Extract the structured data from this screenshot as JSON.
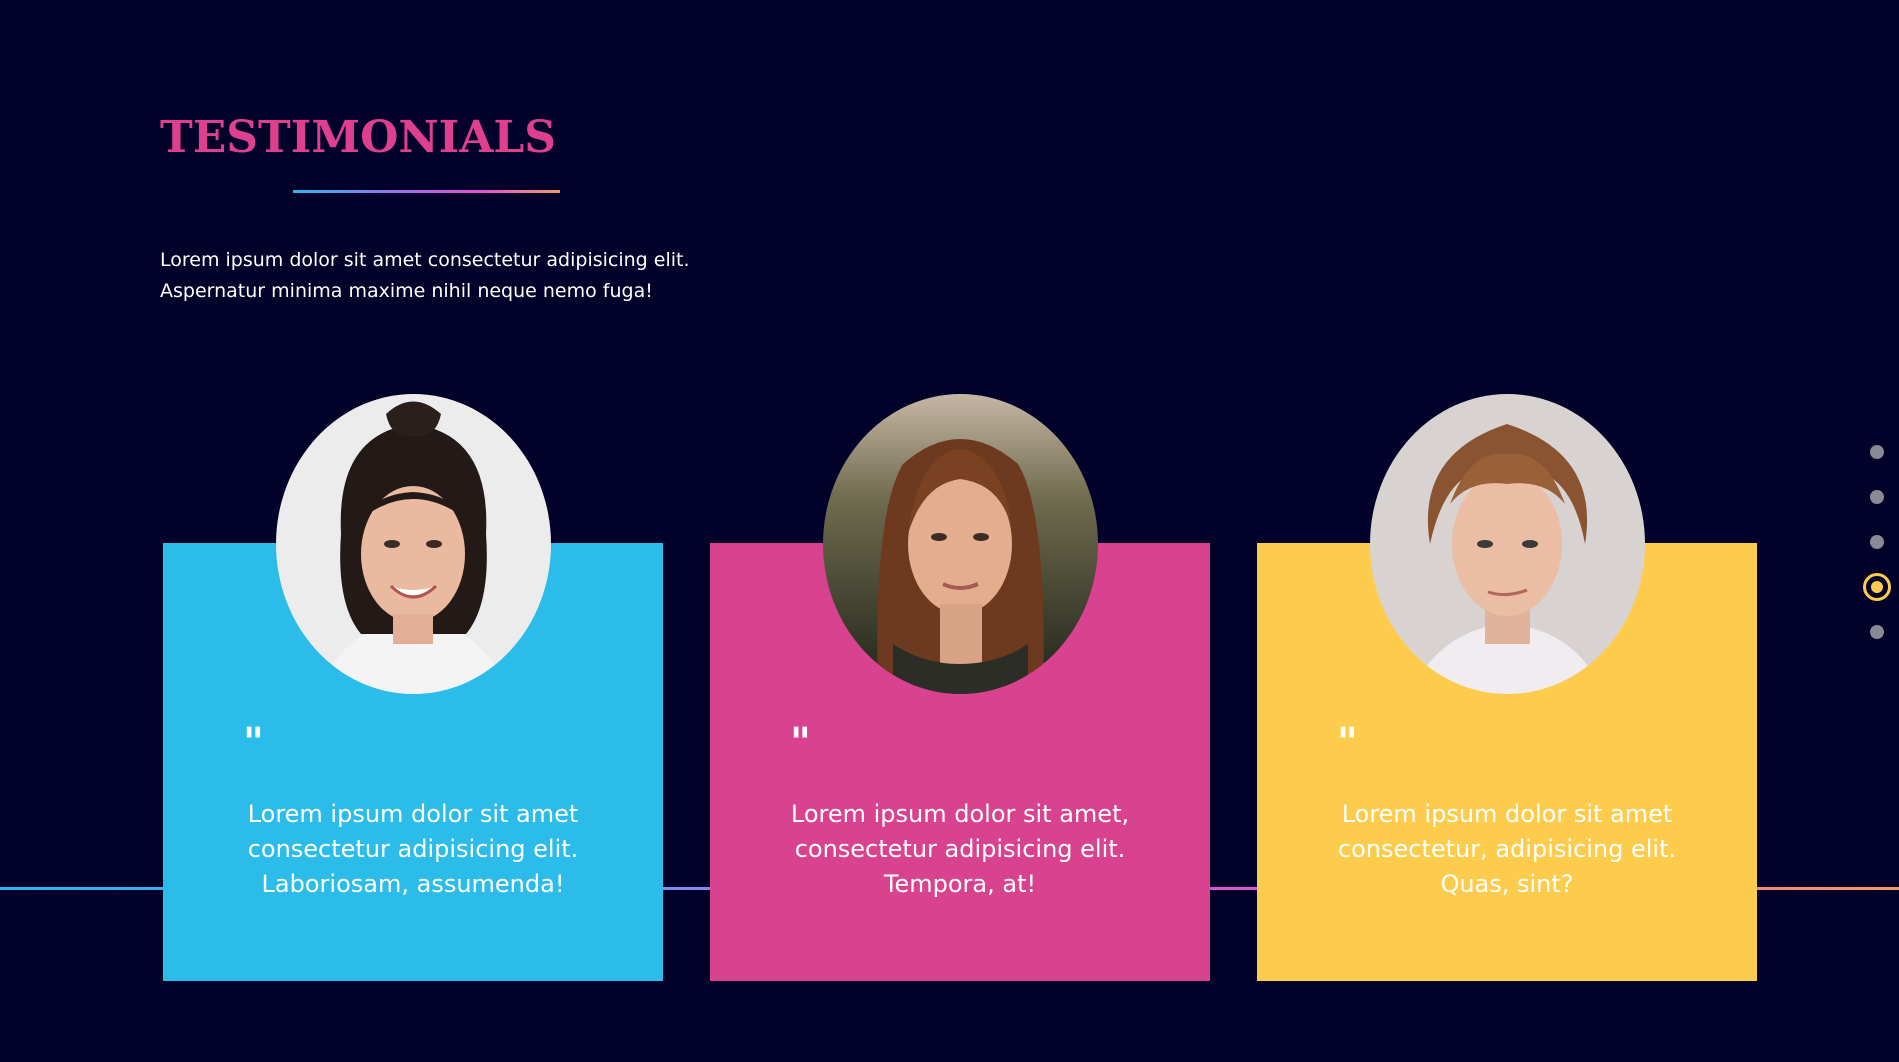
{
  "section": {
    "title": "TESTIMONIALS",
    "intro_line1": "Lorem ipsum dolor sit amet consectetur adipisicing elit.",
    "intro_line2": "Aspernatur minima maxime nihil neque nemo fuga!"
  },
  "testimonials": [
    {
      "color": "#2bbcea",
      "quote_icon": "quote-icon",
      "lines": [
        "Lorem ipsum dolor sit amet",
        "consectetur adipisicing elit.",
        "Laboriosam, assumenda!"
      ]
    },
    {
      "color": "#d9428f",
      "quote_icon": "quote-icon",
      "lines": [
        "Lorem ipsum dolor sit amet,",
        "consectetur adipisicing elit.",
        "Tempora, at!"
      ]
    },
    {
      "color": "#fdcc4c",
      "quote_icon": "quote-icon",
      "lines": [
        "Lorem ipsum dolor sit amet",
        "consectetur, adipisicing elit.",
        "Quas, sint?"
      ]
    }
  ],
  "quote_mark": "\"",
  "pagination": {
    "count": 5,
    "active_index": 3,
    "active_color": "#fdcc4c"
  },
  "colors": {
    "background": "#01012a",
    "title": "#df3f8f"
  }
}
